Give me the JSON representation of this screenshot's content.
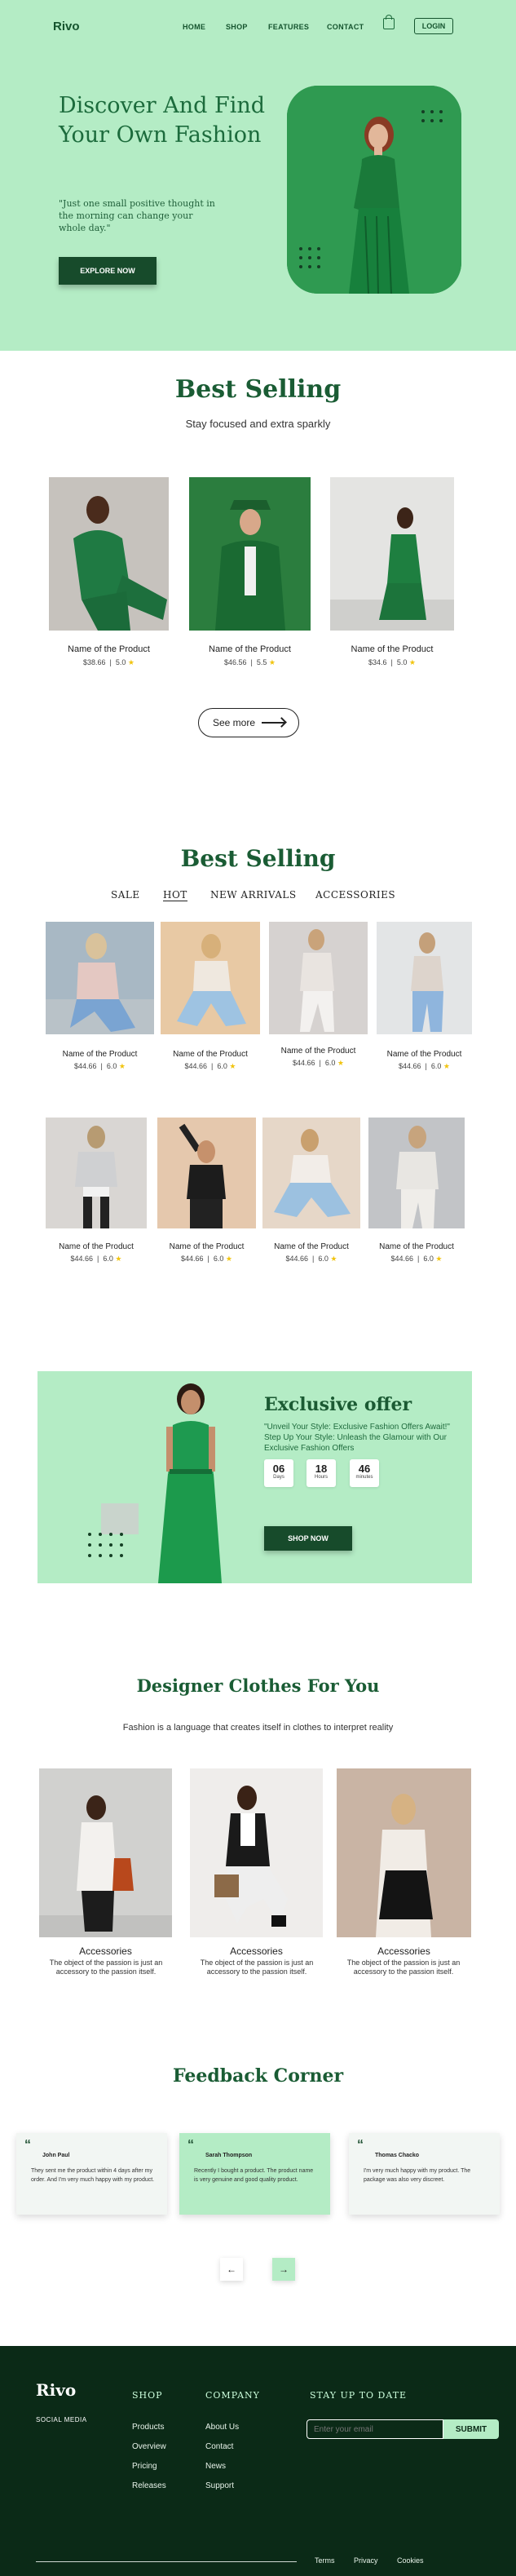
{
  "nav": {
    "logo": "Rivo",
    "links": [
      "HOME",
      "SHOP",
      "FEATURES",
      "CONTACT"
    ],
    "login": "LOGIN"
  },
  "hero": {
    "title": "Discover And Find Your Own Fashion",
    "subtitle": "\"Just one small positive thought in the morning can change your whole day.\"",
    "cta": "EXPLORE NOW"
  },
  "best1": {
    "title": "Best Selling",
    "subtitle": "Stay focused and extra sparkly",
    "products": [
      {
        "name": "Name of the Product",
        "price": "$38.66",
        "rating": "5.0"
      },
      {
        "name": "Name of the Product",
        "price": "$46.56",
        "rating": "5.5"
      },
      {
        "name": "Name of the Product",
        "price": "$34.6",
        "rating": "5.0"
      }
    ],
    "see_more": "See more"
  },
  "best2": {
    "title": "Best Selling",
    "tabs": [
      "SALE",
      "HOT",
      "NEW ARRIVALS",
      "ACCESSORIES"
    ],
    "active_tab": "HOT",
    "products": [
      {
        "name": "Name of the Product",
        "price": "$44.66",
        "rating": "6.0"
      },
      {
        "name": "Name of the Product",
        "price": "$44.66",
        "rating": "6.0"
      },
      {
        "name": "Name of the Product",
        "price": "$44.66",
        "rating": "6.0"
      },
      {
        "name": "Name of the Product",
        "price": "$44.66",
        "rating": "6.0"
      },
      {
        "name": "Name of the Product",
        "price": "$44.66",
        "rating": "6.0"
      },
      {
        "name": "Name of the Product",
        "price": "$44.66",
        "rating": "6.0"
      },
      {
        "name": "Name of the Product",
        "price": "$44.66",
        "rating": "6.0"
      },
      {
        "name": "Name of the Product",
        "price": "$44.66",
        "rating": "6.0"
      }
    ]
  },
  "offer": {
    "title": "Exclusive offer",
    "text": "\"Unveil Your Style: Exclusive Fashion Offers Await!\" Step Up Your Style: Unleash the Glamour with Our Exclusive Fashion Offers",
    "countdown": [
      {
        "value": "06",
        "label": "Days"
      },
      {
        "value": "18",
        "label": "Hours"
      },
      {
        "value": "46",
        "label": "minutes"
      }
    ],
    "cta": "SHOP NOW"
  },
  "designer": {
    "title": "Designer Clothes For You",
    "subtitle": "Fashion is a language that creates itself in clothes to interpret reality",
    "items": [
      {
        "title": "Accessories",
        "text": "The object of the passion is just an accessory to the passion itself."
      },
      {
        "title": "Accessories",
        "text": "The object of the passion is just an accessory to the passion itself."
      },
      {
        "title": "Accessories",
        "text": "The object of the passion is just an accessory to the passion itself."
      }
    ]
  },
  "feedback": {
    "title": "Feedback Corner",
    "cards": [
      {
        "name": "John Paul",
        "text": "They sent me the product within 4 days after my order. And I'm very much happy with my product."
      },
      {
        "name": "Sarah Thompson",
        "text": "Recently I bought a product. The product name is very genuine and good quality product."
      },
      {
        "name": "Thomas Chacko",
        "text": "I'm very much happy with my product. The package was also very discreet."
      }
    ],
    "prev": "←",
    "next": "→"
  },
  "footer": {
    "logo": "Rivo",
    "social": "SOCIAL MEDIA",
    "shop_heading": "SHOP",
    "shop_links": [
      "Products",
      "Overview",
      "Pricing",
      "Releases"
    ],
    "company_heading": "COMPANY",
    "company_links": [
      "About Us",
      "Contact",
      "News",
      "Support"
    ],
    "newsletter_heading": "STAY UP TO DATE",
    "email_placeholder": "Enter your email",
    "submit": "SUBMIT",
    "legal": [
      "Terms",
      "Privacy",
      "Cookies"
    ]
  },
  "colors": {
    "mint": "#b4ecc5",
    "green": "#2f9a51",
    "dark_green": "#174b2b",
    "footer": "#0b2a17"
  }
}
